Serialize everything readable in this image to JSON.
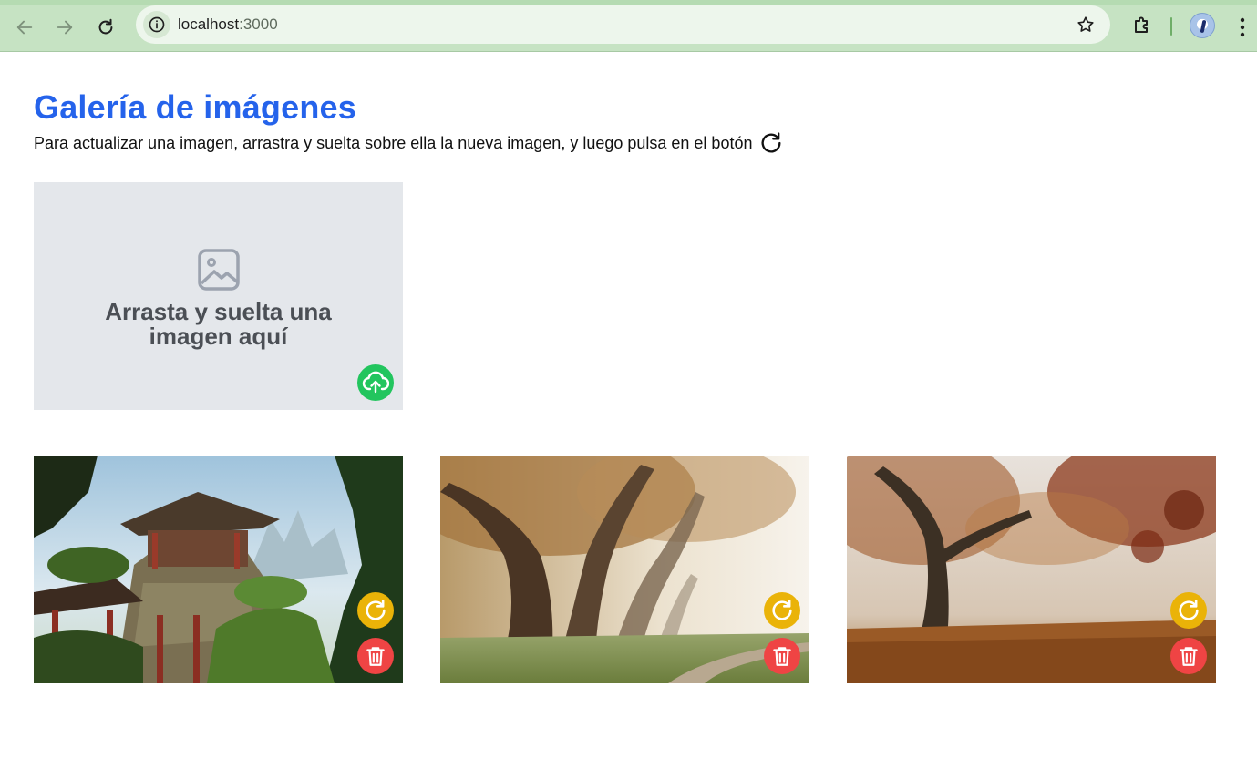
{
  "browser": {
    "url_host": "localhost",
    "url_port": ":3000",
    "back_icon": "arrow-left-icon",
    "forward_icon": "arrow-right-icon",
    "reload_icon": "reload-icon",
    "bookmark_icon": "star-icon",
    "extensions_icon": "puzzle-icon",
    "menu_icon": "kebab-menu-icon"
  },
  "page": {
    "title": "Galería de imágenes",
    "instructions": "Para actualizar una imagen, arrastra y suelta sobre ella la nueva imagen, y luego pulsa en el botón",
    "instructions_icon": "refresh-icon"
  },
  "dropzone": {
    "text": "Arrasta y suelta una imagen aquí",
    "icon": "image-icon",
    "upload_icon": "cloud-upload-icon",
    "upload_color": "#22c55e"
  },
  "gallery": {
    "images": [
      {
        "subject": "Pagoda on rocky cliff with pine trees"
      },
      {
        "subject": "Misty autumn trees along a path"
      },
      {
        "subject": "Autumn tree with fallen leaves in fog"
      }
    ],
    "refresh_icon": "refresh-icon",
    "refresh_color": "#eab308",
    "delete_icon": "trash-icon",
    "delete_color": "#ef4444"
  }
}
